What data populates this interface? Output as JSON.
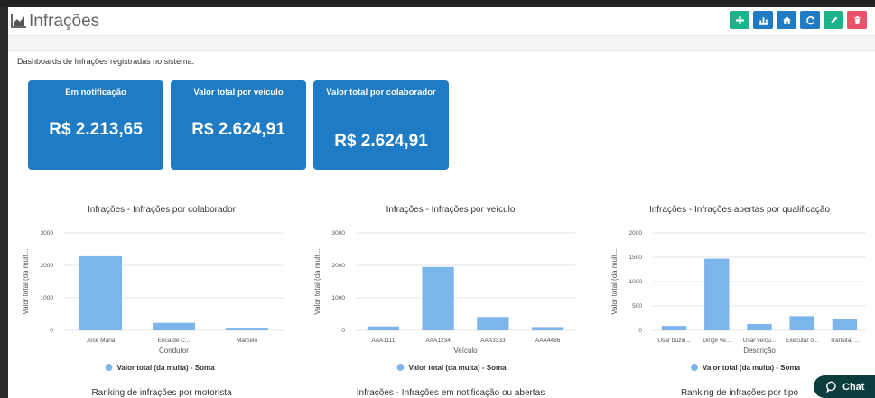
{
  "header": {
    "title": "Infrações",
    "buttons": [
      {
        "icon": "plus-icon",
        "color": "#1cb38b"
      },
      {
        "icon": "chart-icon",
        "color": "#1f7bc4"
      },
      {
        "icon": "home-icon",
        "color": "#1f7bc4"
      },
      {
        "icon": "refresh-icon",
        "color": "#1f7bc4"
      },
      {
        "icon": "pencil-icon",
        "color": "#1cb38b"
      },
      {
        "icon": "trash-icon",
        "color": "#e9546b"
      }
    ]
  },
  "description": "Dashboards de Infrações registradas no sistema.",
  "cards": [
    {
      "label": "Em notificação",
      "value": "R$ 2.213,65"
    },
    {
      "label": "Valor total por veículo",
      "value": "R$ 2.624,91"
    },
    {
      "label": "Valor total por colaborador",
      "value": "R$ 2.624,91"
    }
  ],
  "chart_data": [
    {
      "type": "bar",
      "title": "Infrações - Infrações por colaborador",
      "categories": [
        "José Maria",
        "Érica de C...",
        "Marcelo"
      ],
      "series": [
        {
          "name": "Valor total (da multa) - Soma",
          "values": [
            2280,
            230,
            80
          ]
        }
      ],
      "xlabel": "Condutor",
      "ylabel": "Valor total (da mult...",
      "ylim": [
        0,
        3000
      ],
      "yticks": [
        "0",
        "1000",
        "2000",
        "3000"
      ],
      "legend": "bottom",
      "color": "#7cb5ec"
    },
    {
      "type": "bar",
      "title": "Infrações - Infrações por veículo",
      "categories": [
        "AAA1111",
        "AAA1234",
        "AAA3333",
        "AAA4466"
      ],
      "series": [
        {
          "name": "Valor total (da multa) - Soma",
          "values": [
            120,
            1950,
            410,
            100
          ]
        }
      ],
      "xlabel": "Veículo",
      "ylabel": "Valor total (da mult...",
      "ylim": [
        0,
        3000
      ],
      "yticks": [
        "0",
        "1000",
        "2000",
        "3000"
      ],
      "legend": "bottom",
      "color": "#7cb5ec"
    },
    {
      "type": "bar",
      "title": "Infrações - Infrações abertas por qualificação",
      "categories": [
        "Usar buzin...",
        "Dirigir ve...",
        "Usar veícu...",
        "Executar o...",
        "Transitar ..."
      ],
      "series": [
        {
          "name": "Valor total (da multa) - Soma",
          "values": [
            90,
            1470,
            130,
            290,
            230
          ]
        }
      ],
      "xlabel": "Descrição",
      "ylabel": "Valor total (da mult...",
      "ylim": [
        0,
        2000
      ],
      "yticks": [
        "0",
        "500",
        "1000",
        "1500",
        "2000"
      ],
      "legend": "bottom",
      "color": "#7cb5ec"
    }
  ],
  "bottom_titles": [
    "Ranking de infrações por motorista",
    "Infrações - Infrações em notificação ou abertas",
    "Ranking de infrações por tipo"
  ],
  "chat": {
    "label": "Chat"
  }
}
